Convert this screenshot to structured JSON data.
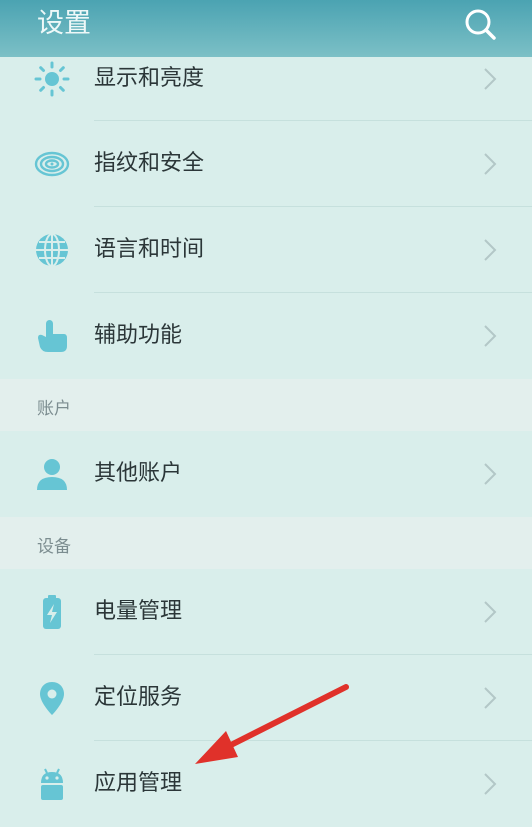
{
  "header": {
    "title": "设置",
    "search_icon": "search-icon"
  },
  "rows": {
    "display": {
      "label": "显示和亮度",
      "icon": "brightness-icon"
    },
    "fingerprint": {
      "label": "指纹和安全",
      "icon": "fingerprint-icon"
    },
    "language": {
      "label": "语言和时间",
      "icon": "globe-icon"
    },
    "accessibility": {
      "label": "辅助功能",
      "icon": "hand-pointer-icon"
    },
    "other_accounts": {
      "label": "其他账户",
      "icon": "person-icon"
    },
    "battery": {
      "label": "电量管理",
      "icon": "battery-icon"
    },
    "location": {
      "label": "定位服务",
      "icon": "location-pin-icon"
    },
    "apps": {
      "label": "应用管理",
      "icon": "android-icon"
    }
  },
  "sections": {
    "accounts": "账户",
    "device": "设备"
  },
  "colors": {
    "header": "#5fb1bd",
    "background": "#dcedeb",
    "icon": "#66c5d4",
    "chevron": "#b3c7c7",
    "arrow": "#e0312a"
  }
}
